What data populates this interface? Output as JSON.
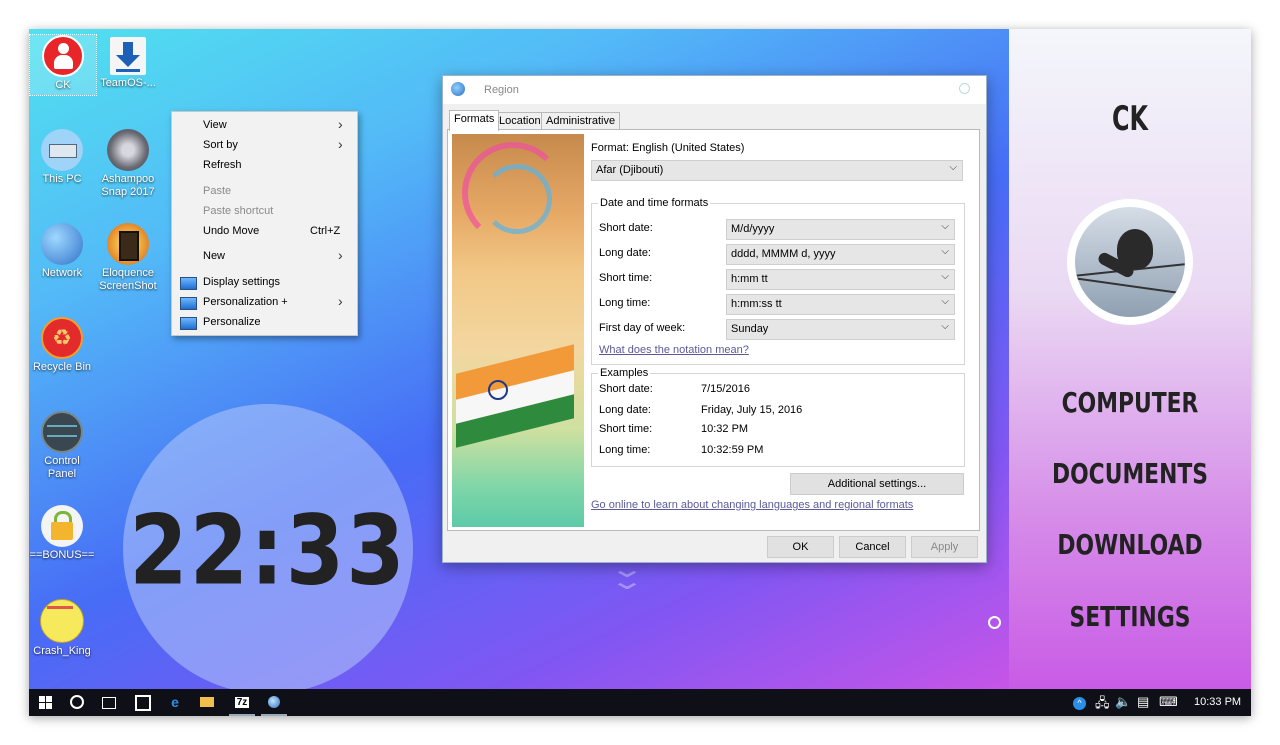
{
  "desktop": {
    "icons": [
      {
        "label": "CK",
        "icon": "user-icon"
      },
      {
        "label": "TeamOS-...",
        "icon": "download-arrow-icon"
      },
      {
        "label": "This PC",
        "icon": "this-pc-icon"
      },
      {
        "label": "Ashampoo Snap 2017",
        "icon": "ashampoo-snap-icon"
      },
      {
        "label": "Network",
        "icon": "network-globe-icon"
      },
      {
        "label": "Eloquence ScreenShot",
        "icon": "eloquence-screenshot-icon"
      },
      {
        "label": "Recycle Bin",
        "icon": "recycle-bin-icon"
      },
      {
        "label": "Control Panel",
        "icon": "control-panel-icon"
      },
      {
        "label": "==BONUS==",
        "icon": "bonus-lock-icon"
      },
      {
        "label": "Crash_King",
        "icon": "crash-king-icon"
      }
    ],
    "clock": "22:33"
  },
  "side_panel": {
    "title": "CK",
    "links": [
      "COMPUTER",
      "DOCUMENTS",
      "DOWNLOAD",
      "SETTINGS"
    ]
  },
  "context_menu": {
    "view": "View",
    "sort_by": "Sort by",
    "refresh": "Refresh",
    "paste": "Paste",
    "paste_shortcut": "Paste shortcut",
    "undo_move": "Undo Move",
    "undo_shortcut": "Ctrl+Z",
    "new": "New",
    "display_settings": "Display settings",
    "personalization_plus": "Personalization +",
    "personalize": "Personalize"
  },
  "region_dialog": {
    "title": "Region",
    "tabs": [
      "Formats",
      "Location",
      "Administrative"
    ],
    "format_label": "Format: English (United States)",
    "format_value": "Afar (Djibouti)",
    "date_time_group": "Date and time formats",
    "fields": [
      {
        "label": "Short date:",
        "value": "M/d/yyyy"
      },
      {
        "label": "Long date:",
        "value": "dddd, MMMM d, yyyy"
      },
      {
        "label": "Short time:",
        "value": "h:mm tt"
      },
      {
        "label": "Long time:",
        "value": "h:mm:ss tt"
      },
      {
        "label": "First day of week:",
        "value": "Sunday"
      }
    ],
    "notation_link": "What does the notation mean?",
    "examples_group": "Examples",
    "examples": [
      {
        "label": "Short date:",
        "value": "7/15/2016"
      },
      {
        "label": "Long date:",
        "value": "Friday, July 15, 2016"
      },
      {
        "label": "Short time:",
        "value": "10:32 PM"
      },
      {
        "label": "Long time:",
        "value": "10:32:59 PM"
      }
    ],
    "additional_settings": "Additional settings...",
    "online_link": "Go online to learn about changing languages and regional formats",
    "ok": "OK",
    "cancel": "Cancel",
    "apply": "Apply"
  },
  "taskbar": {
    "time": "10:33 PM",
    "seven_zip": "7z"
  }
}
